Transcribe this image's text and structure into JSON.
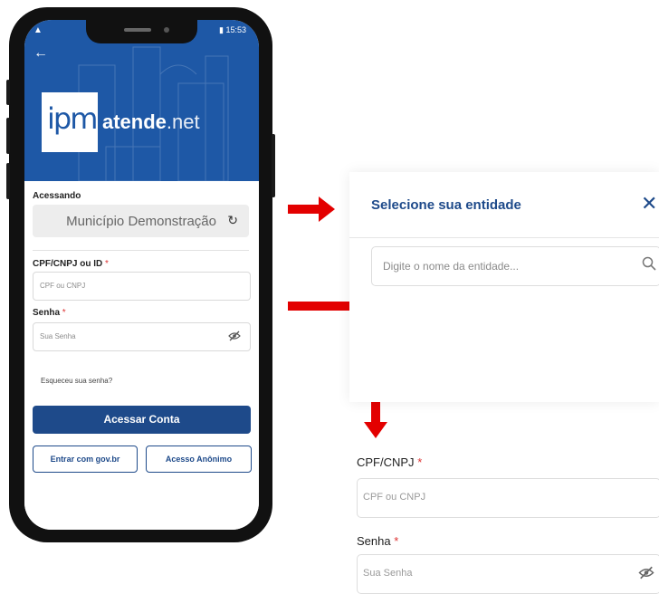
{
  "status_bar": {
    "time": "15:53"
  },
  "app": {
    "logo_ipm": "ipm",
    "logo_atende": "atende",
    "logo_net": ".net"
  },
  "login": {
    "accessing_label": "Acessando",
    "entity_name": "Município Demonstração",
    "cpf_label": "CPF/CNPJ ou ID",
    "cpf_placeholder": "CPF ou CNPJ",
    "password_label": "Senha",
    "password_placeholder": "Sua Senha",
    "required_mark": "*",
    "forgot_password": "Esqueceu sua senha?",
    "submit_button": "Acessar Conta",
    "govbr_button": "Entrar com gov.br",
    "anonymous_button": "Acesso Anônimo"
  },
  "entity_modal": {
    "title": "Selecione sua entidade",
    "search_placeholder": "Digite o nome da entidade..."
  },
  "zoom_fields": {
    "cpf_label": "CPF/CNPJ",
    "cpf_placeholder": "CPF ou CNPJ",
    "password_label": "Senha",
    "password_placeholder": "Sua Senha",
    "required_mark": "*"
  },
  "colors": {
    "brand_blue": "#1e58a6",
    "button_blue": "#1e4a8a",
    "arrow_red": "#e30000",
    "required_red": "#dd3333"
  },
  "icons": [
    "back-arrow-icon",
    "refresh-icon",
    "eye-off-icon",
    "close-icon",
    "search-icon"
  ]
}
